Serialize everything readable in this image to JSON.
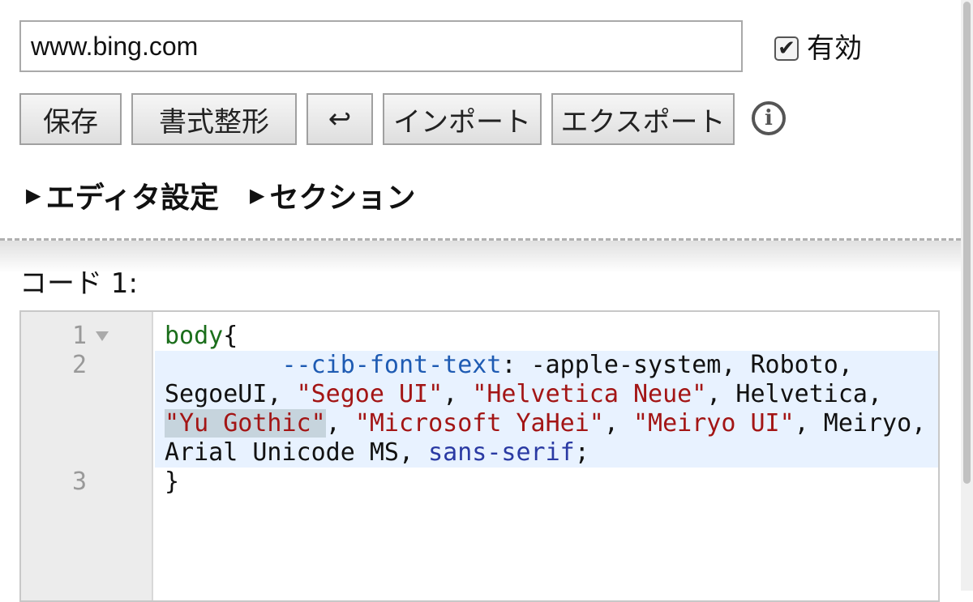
{
  "url_field": {
    "value": "www.bing.com"
  },
  "enable": {
    "label": "有効",
    "checked": true,
    "check_glyph": "✔"
  },
  "toolbar": {
    "save": "保存",
    "format": "書式整形",
    "wrap": "↩",
    "import": "インポート",
    "export": "エクスポート",
    "info_glyph": "i"
  },
  "sections": {
    "triangle": "▶",
    "editor_settings": "エディタ設定",
    "section": "セクション"
  },
  "code_block": {
    "label": "コード 1:",
    "line_numbers": [
      "1",
      "2",
      "3"
    ],
    "lines": {
      "l1_selector": "body",
      "l1_brace": "{",
      "l2_indent": "        ",
      "l2_prop": "--cib-font-text",
      "l2_colon": ": ",
      "l2_val1": "-apple-system, Roboto,",
      "l3_a": "SegoeUI, ",
      "l3_s1": "\"Segoe UI\"",
      "l3_c1": ", ",
      "l3_s2": "\"Helvetica Neue\"",
      "l3_b": ", Helvetica,",
      "l4_s1": "\"Yu Gothic\"",
      "l4_c1": ", ",
      "l4_s2": "\"Microsoft YaHei\"",
      "l4_c2": ", ",
      "l4_s3": "\"Meiryo UI\"",
      "l4_b": ", Meiryo,",
      "l5_a": "Arial Unicode MS, ",
      "l5_kw": "sans-serif",
      "l5_end": ";",
      "l6_brace": "}"
    }
  },
  "colors": {
    "selector": "#1b6e1b",
    "property": "#1e5bb3",
    "string": "#a31515",
    "keyword": "#2a3aa3",
    "active_line": "#e8f2ff"
  }
}
